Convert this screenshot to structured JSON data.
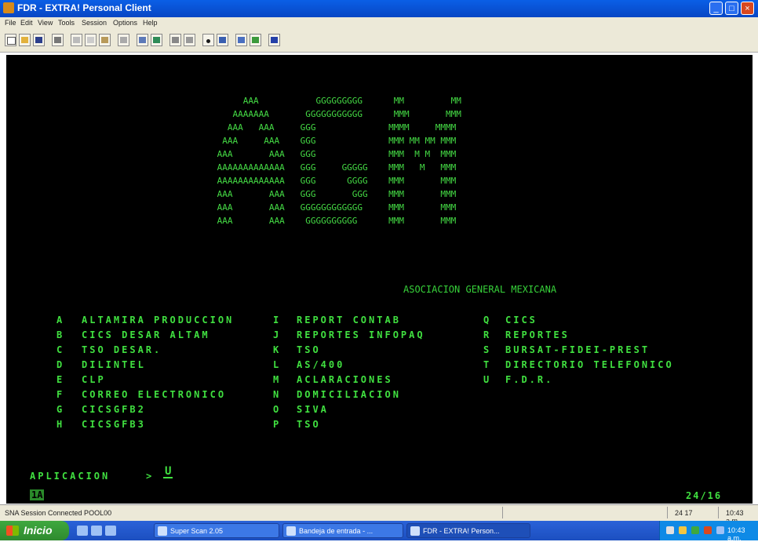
{
  "window": {
    "title": "FDR - EXTRA! Personal Client",
    "minimize": "_",
    "maximize": "□",
    "close": "×"
  },
  "menu": [
    "File",
    "Edit",
    "View",
    "Tools",
    "Session",
    "Options",
    "Help"
  ],
  "toolbar": {
    "icons": [
      "new-session-icon",
      "open-icon",
      "save-icon",
      "print-icon",
      "cut-icon",
      "copy-icon",
      "paste-icon",
      "find-icon",
      "display-icon",
      "macro-icon",
      "record-icon",
      "send-icon",
      "hotspot-icon",
      "keyboard-icon",
      "settings-icon",
      "chart-icon",
      "help-icon"
    ]
  },
  "terminal": {
    "logo_lines": [
      "      AAA           GGGGGGGGG      MM         MM",
      "    AAAAAAA       GGGGGGGGGGG      MMM       MMM",
      "   AAA   AAA     GGG              MMMM     MMMM",
      "  AAA     AAA    GGG              MMM MM MM MMM",
      " AAA       AAA   GGG              MMM  M M  MMM",
      " AAAAAAAAAAAAA   GGG     GGGGG    MMM   M   MMM",
      " AAAAAAAAAAAAA   GGG      GGGG    MMM       MMM",
      " AAA       AAA   GGG       GGG    MMM       MMM",
      " AAA       AAA   GGGGGGGGGGGG     MMM       MMM",
      " AAA       AAA    GGGGGGGGGG      MMM       MMM"
    ],
    "org_name": "ASOCIACION GENERAL MEXICANA",
    "menu_col1": [
      {
        "key": "A",
        "label": "ALTAMIRA PRODUCCION"
      },
      {
        "key": "B",
        "label": "CICS DESAR ALTAM"
      },
      {
        "key": "C",
        "label": "TSO DESAR."
      },
      {
        "key": "D",
        "label": "DILINTEL"
      },
      {
        "key": "E",
        "label": "CLP"
      },
      {
        "key": "F",
        "label": "CORREO ELECTRONICO"
      },
      {
        "key": "G",
        "label": "CICSGFB2"
      },
      {
        "key": "H",
        "label": "CICSGFB3"
      }
    ],
    "menu_col2": [
      {
        "key": "I",
        "label": "REPORT CONTAB"
      },
      {
        "key": "J",
        "label": "REPORTES INFOPAQ"
      },
      {
        "key": "K",
        "label": "TSO"
      },
      {
        "key": "L",
        "label": "AS/400"
      },
      {
        "key": "M",
        "label": "ACLARACIONES"
      },
      {
        "key": "N",
        "label": "DOMICILIACION"
      },
      {
        "key": "O",
        "label": "SIVA"
      },
      {
        "key": "P",
        "label": "TSO"
      }
    ],
    "menu_col3": [
      {
        "key": "Q",
        "label": "CICS"
      },
      {
        "key": "R",
        "label": "REPORTES"
      },
      {
        "key": "S",
        "label": "BURSAT-FIDEI-PREST"
      },
      {
        "key": "T",
        "label": "DIRECTORIO TELEFONICO"
      },
      {
        "key": "U",
        "label": "F.D.R."
      }
    ],
    "prompt_label": "APLICACION",
    "prompt_arrow": ">",
    "prompt_value": "U",
    "oia_left": "1A",
    "oia_right": "24/16"
  },
  "status": {
    "message": "SNA Session Connected POOL00",
    "position": "24 17",
    "time": "10:43 a.m."
  },
  "taskbar": {
    "start_label": "Inicio",
    "tasks": [
      "Super Scan 2.05",
      "Bandeja de entrada - ...",
      "FDR - EXTRA! Person..."
    ],
    "clock": "10:43 a.m."
  },
  "colors": {
    "terminal_bg": "#000000",
    "terminal_fg": "#37d23a",
    "titlebar": "#0a5fe6",
    "taskbar": "#2a62d8"
  }
}
